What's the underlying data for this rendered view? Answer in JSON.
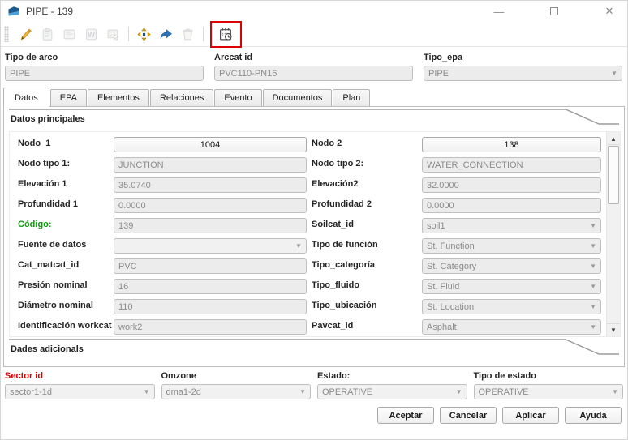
{
  "window": {
    "title": "PIPE - 139",
    "controls": {
      "minimize": "—",
      "close": "✕"
    }
  },
  "toolbar": {
    "highlight_color": "#dd0000",
    "icons": [
      {
        "name": "edit-pencil-icon",
        "enabled": true
      },
      {
        "name": "paste-icon",
        "enabled": false
      },
      {
        "name": "catalog-icon",
        "enabled": false
      },
      {
        "name": "word-document-icon",
        "enabled": false
      },
      {
        "name": "select-image-icon",
        "enabled": false
      },
      {
        "name": "move-node-icon",
        "enabled": true
      },
      {
        "name": "flow-direction-arrow-icon",
        "enabled": true
      },
      {
        "name": "delete-icon",
        "enabled": false
      },
      {
        "name": "workcat-calendar-clock-icon",
        "enabled": true,
        "highlighted": true
      }
    ]
  },
  "header_fields": {
    "arc_type": {
      "label": "Tipo de arco",
      "value": "PIPE"
    },
    "arccat_id": {
      "label": "Arccat id",
      "value": "PVC110-PN16"
    },
    "epa_type": {
      "label": "Tipo_epa",
      "value": "PIPE"
    }
  },
  "tabs": [
    {
      "label": "Datos",
      "active": true
    },
    {
      "label": "EPA"
    },
    {
      "label": "Elementos"
    },
    {
      "label": "Relaciones"
    },
    {
      "label": "Evento"
    },
    {
      "label": "Documentos"
    },
    {
      "label": "Plan"
    }
  ],
  "sections": {
    "main": "Datos principales",
    "additional": "Dades adicionals"
  },
  "form": {
    "left": [
      {
        "label": "Nodo_1",
        "value": "1004",
        "type": "button"
      },
      {
        "label": "Nodo tipo 1:",
        "value": "JUNCTION",
        "type": "input"
      },
      {
        "label": "Elevación 1",
        "value": "35.0740",
        "type": "input"
      },
      {
        "label": "Profundidad 1",
        "value": "0.0000",
        "type": "input"
      },
      {
        "label": "Código:",
        "value": "139",
        "type": "input",
        "label_color": "#0f9c0f"
      },
      {
        "label": "Fuente de datos",
        "value": "",
        "type": "select"
      },
      {
        "label": "Cat_matcat_id",
        "value": "PVC",
        "type": "input"
      },
      {
        "label": "Presión nominal",
        "value": "16",
        "type": "input"
      },
      {
        "label": "Diámetro nominal",
        "value": "110",
        "type": "input"
      },
      {
        "label": "Identificación workcat",
        "value": "work2",
        "type": "input"
      }
    ],
    "right": [
      {
        "label": "Nodo 2",
        "value": "138",
        "type": "button"
      },
      {
        "label": "Nodo tipo 2:",
        "value": "WATER_CONNECTION",
        "type": "input"
      },
      {
        "label": "Elevación2",
        "value": "32.0000",
        "type": "input"
      },
      {
        "label": "Profundidad 2",
        "value": "0.0000",
        "type": "input"
      },
      {
        "label": "Soilcat_id",
        "value": "soil1",
        "type": "select"
      },
      {
        "label": "Tipo de función",
        "value": "St. Function",
        "type": "select"
      },
      {
        "label": "Tipo_categoría",
        "value": "St. Category",
        "type": "select"
      },
      {
        "label": "Tipo_fluido",
        "value": "St. Fluid",
        "type": "select"
      },
      {
        "label": "Tipo_ubicación",
        "value": "St. Location",
        "type": "select"
      },
      {
        "label": "Pavcat_id",
        "value": "Asphalt",
        "type": "select"
      }
    ]
  },
  "footer": {
    "fields": [
      {
        "label": "Sector id",
        "value": "sector1-1d",
        "label_color": "#dd0000"
      },
      {
        "label": "Omzone",
        "value": "dma1-2d"
      },
      {
        "label": "Estado:",
        "value": "OPERATIVE"
      },
      {
        "label": "Tipo de estado",
        "value": "OPERATIVE"
      }
    ],
    "buttons": [
      {
        "label": "Aceptar"
      },
      {
        "label": "Cancelar"
      },
      {
        "label": "Aplicar"
      },
      {
        "label": "Ayuda"
      }
    ]
  }
}
